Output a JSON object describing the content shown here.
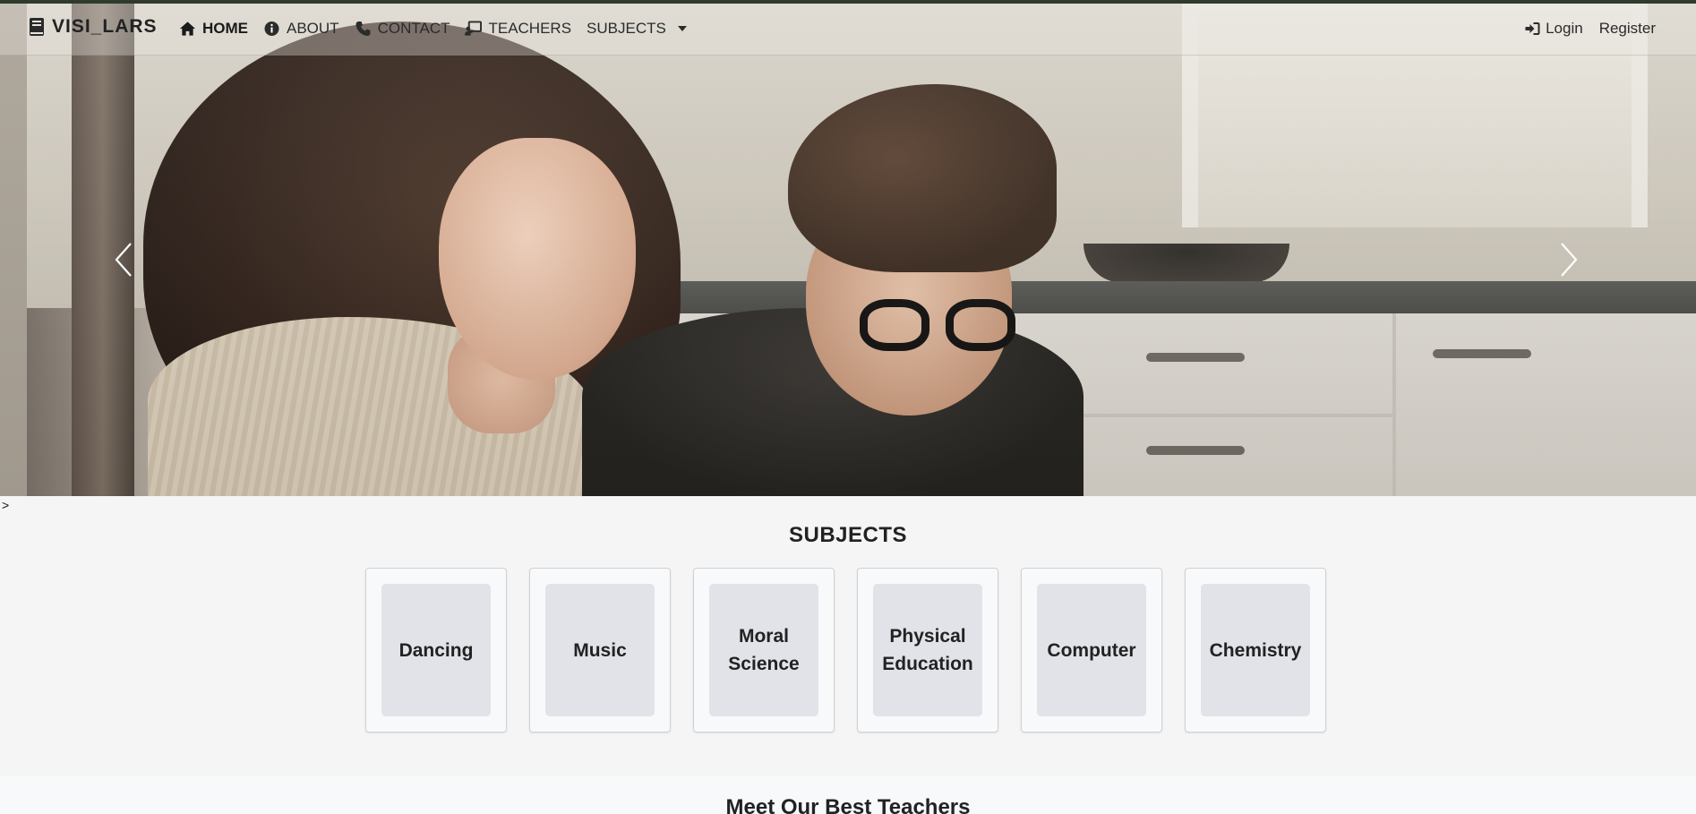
{
  "brand": {
    "name": "VISI_LARS",
    "icon": "book-icon"
  },
  "nav": {
    "home": "HOME",
    "about": "ABOUT",
    "contact": "CONTACT",
    "teachers": "TEACHERS",
    "subjects": "SUBJECTS"
  },
  "auth": {
    "login": "Login",
    "register": "Register"
  },
  "carousel": {
    "prev_icon": "chevron-left-icon",
    "next_icon": "chevron-right-icon"
  },
  "stray_text": ">",
  "subjects_section": {
    "title": "SUBJECTS",
    "items": [
      "Dancing",
      "Music",
      "Moral Science",
      "Physical Education",
      "Computer",
      "Chemistry"
    ]
  },
  "teachers_section": {
    "title": "Meet Our Best Teachers"
  },
  "colors": {
    "top_strip": "#2f3b2c",
    "card_bg": "#f8f9fa",
    "card_inner": "#e2e3e8",
    "page_bg": "#f5f5f5"
  }
}
